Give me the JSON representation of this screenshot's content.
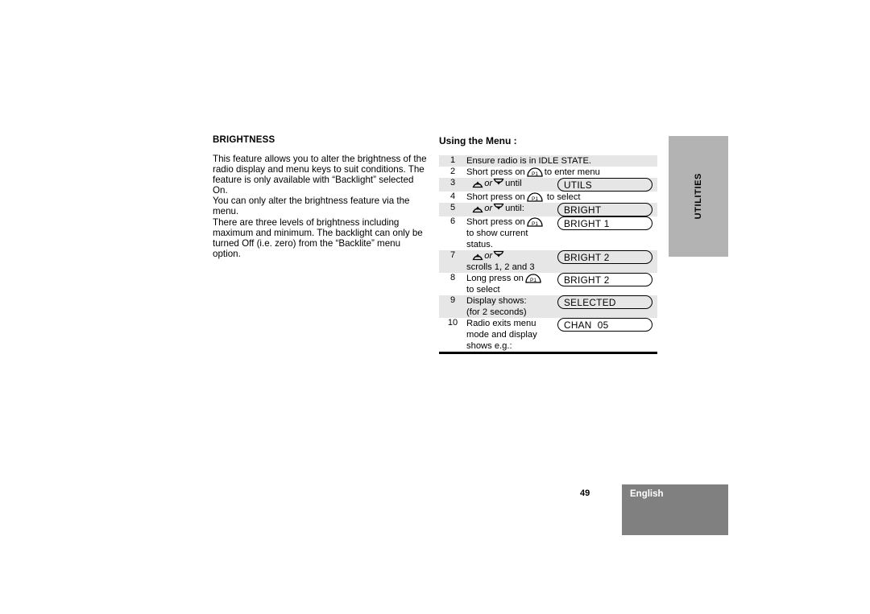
{
  "left_column": {
    "heading": "BRIGHTNESS",
    "paragraphs": [
      "This feature allows you to alter the brightness of the radio display and menu keys to suit conditions. The feature is only available with “Backlight”  selected On.",
      "You can only alter the brightness feature via the menu.",
      "There are three levels of brightness including maximum and minimum. The backlight can only be turned Off (i.e. zero) from the “Backlite” menu option."
    ]
  },
  "right_column": {
    "heading": "Using the Menu :",
    "steps": [
      {
        "number": "1",
        "lines": [
          "Ensure radio is in IDLE STATE."
        ],
        "display": null,
        "shaded": true
      },
      {
        "number": "2",
        "lines": [
          "Short press on ",
          " to enter menu"
        ],
        "icon": "p1-key-icon",
        "display": null,
        "shaded": false
      },
      {
        "number": "3",
        "lines": [
          "",
          " or ",
          " until"
        ],
        "icon": "up-down-arrow-keys",
        "display": "UTILS",
        "shaded": true
      },
      {
        "number": "4",
        "lines": [
          "Short press on ",
          " to select"
        ],
        "icon": "p1-key-icon",
        "display": null,
        "shaded": false
      },
      {
        "number": "5",
        "lines": [
          "",
          " or ",
          " until:"
        ],
        "icon": "up-down-arrow-keys",
        "display": "BRIGHT",
        "shaded": true
      },
      {
        "number": "6",
        "lines": [
          "Short press on ",
          "to show current",
          "status."
        ],
        "icon": "p1-key-icon",
        "display": "BRIGHT 1",
        "shaded": false
      },
      {
        "number": "7",
        "lines": [
          "",
          " or ",
          "scrolls 1, 2 and 3"
        ],
        "icon": "up-down-arrow-keys",
        "display": "BRIGHT 2",
        "shaded": true
      },
      {
        "number": "8",
        "lines": [
          "Long press on ",
          "to select"
        ],
        "icon": "p1-key-icon",
        "display": "BRIGHT 2",
        "shaded": false
      },
      {
        "number": "9",
        "lines": [
          "Display shows:",
          "(for 2 seconds)"
        ],
        "display": "SELECTED",
        "shaded": true
      },
      {
        "number": "10",
        "lines": [
          "Radio exits menu",
          "mode and display",
          "shows e.g.:"
        ],
        "display": "CHAN  05",
        "shaded": false
      }
    ],
    "step_text": {
      "s1_l1": "Ensure radio is in IDLE STATE.",
      "s2_pre": "Short press on",
      "s2_post": "to enter menu",
      "s3_or": "or",
      "s3_post": "until",
      "s4_pre": "Short press on",
      "s4_post": "to select",
      "s5_or": "or",
      "s5_post": "until:",
      "s6_pre": "Short press on",
      "s6_l2": "to show current",
      "s6_l3": "status.",
      "s7_or": "or",
      "s7_l2": "scrolls 1, 2 and 3",
      "s8_pre": "Long press on",
      "s8_l2": "to select",
      "s9_l1": "Display shows:",
      "s9_l2": "(for 2 seconds)",
      "s10_l1": "Radio exits menu",
      "s10_l2": "mode and display",
      "s10_l3": "shows e.g.:"
    }
  },
  "sidebar": {
    "tab_label": "UTILITIES"
  },
  "footer": {
    "page_number": "49",
    "language": "English"
  },
  "colors": {
    "row_shade": "#e6e6e6",
    "sidebar_tab": "#b3b3b3",
    "footer_block": "#808080",
    "text": "#000000"
  }
}
